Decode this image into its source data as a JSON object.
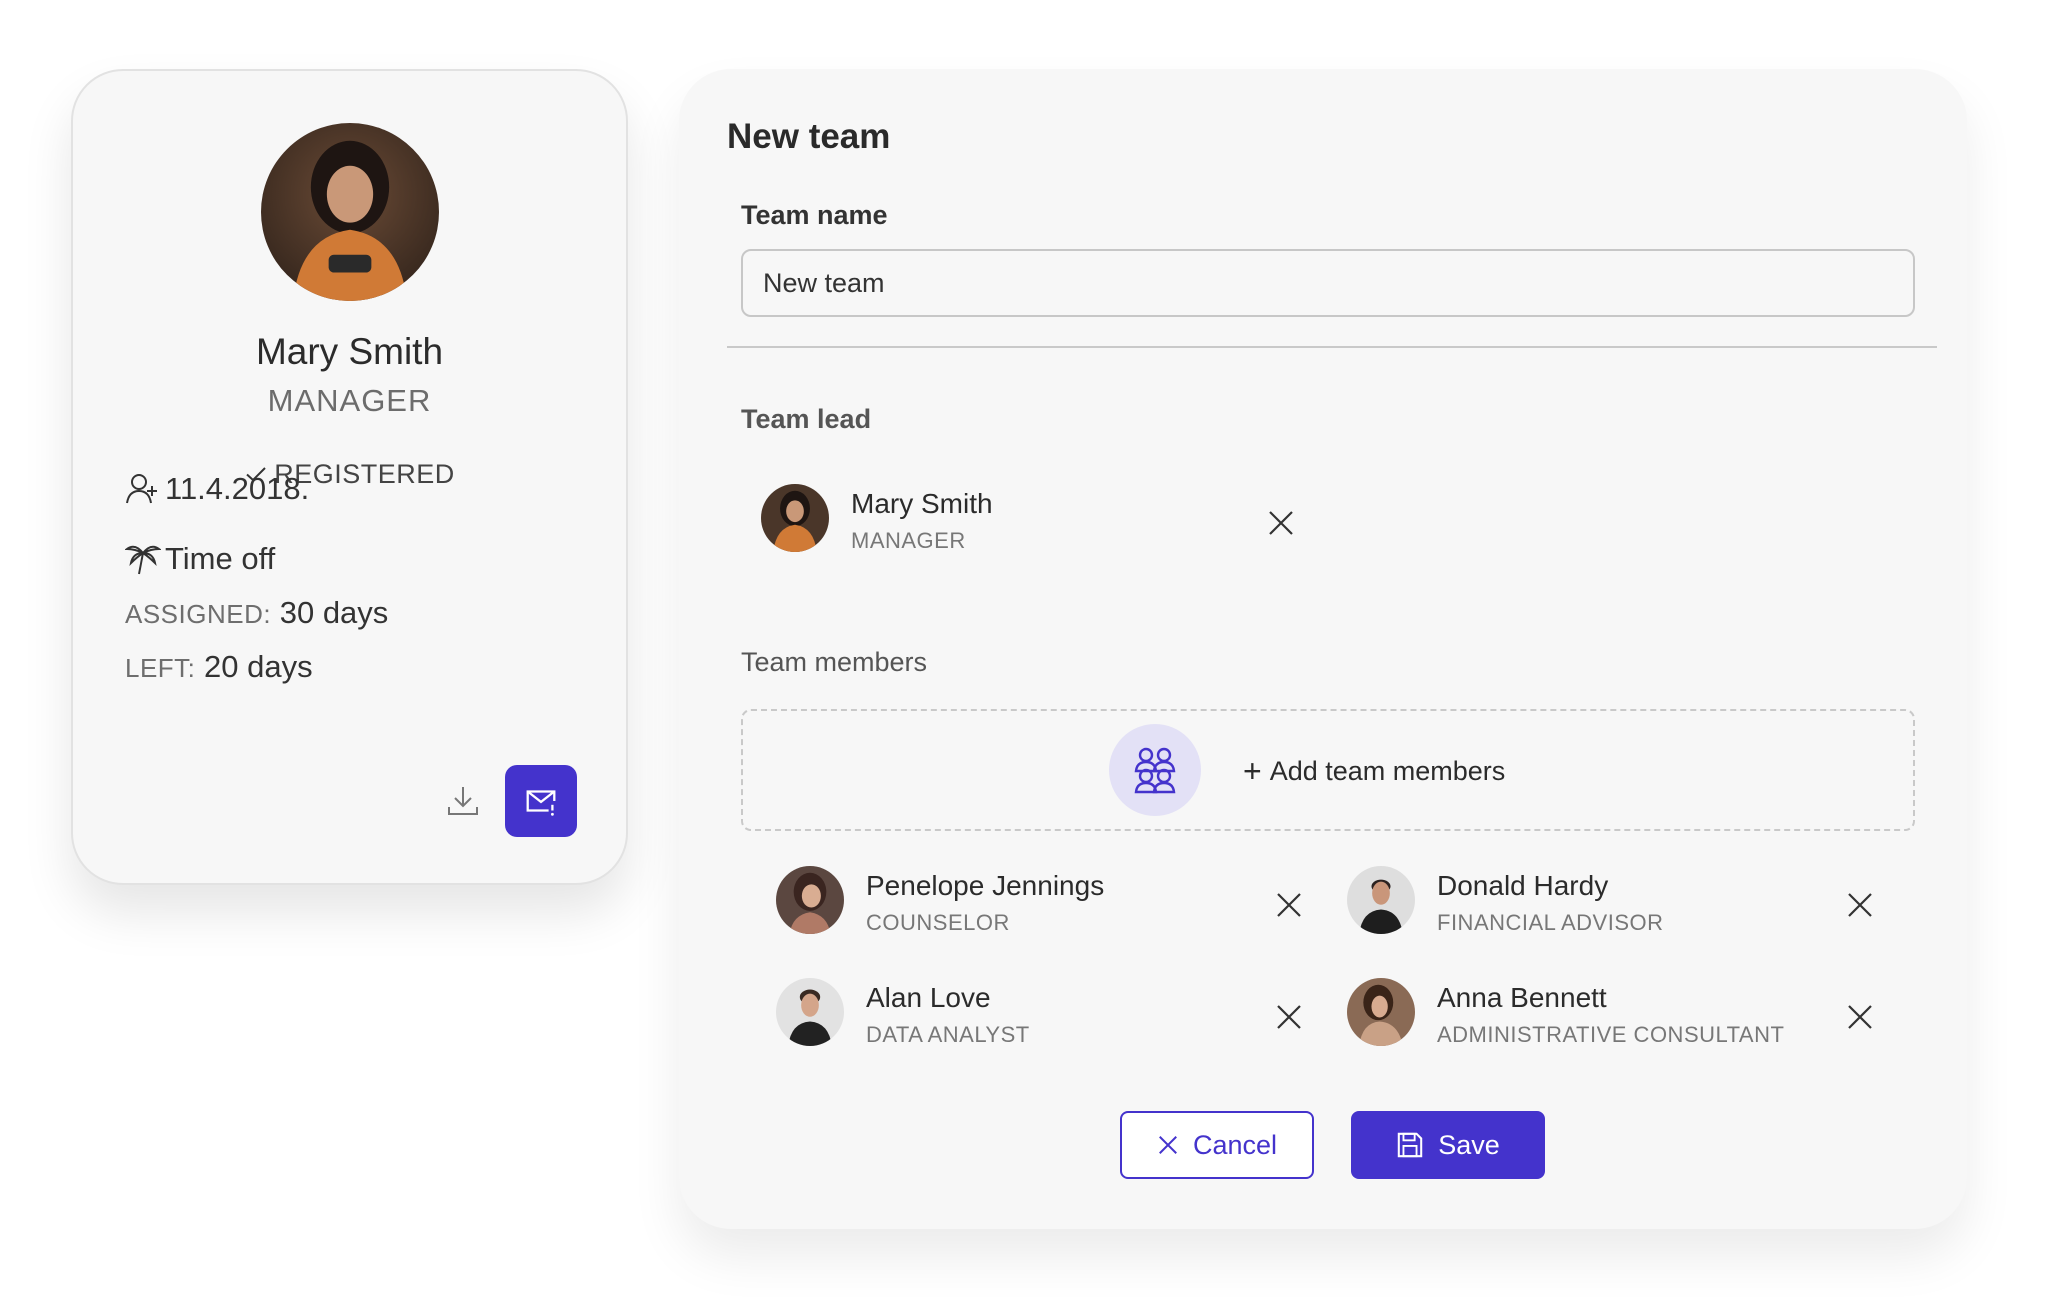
{
  "profile": {
    "name": "Mary Smith",
    "role": "MANAGER",
    "status": "REGISTERED",
    "registered_date": "11.4.2018.",
    "time_off": {
      "title": "Time off",
      "assigned_label": "ASSIGNED:",
      "assigned_value": "30 days",
      "left_label": "LEFT:",
      "left_value": "20 days"
    },
    "icons": [
      "check-icon",
      "user-plus-icon",
      "palm-tree-icon",
      "download-icon",
      "mail-icon"
    ]
  },
  "team_form": {
    "title": "New team",
    "team_name_label": "Team name",
    "team_name_value": "New team",
    "team_lead_label": "Team lead",
    "team_lead": {
      "name": "Mary Smith",
      "role": "MANAGER"
    },
    "team_members_label": "Team members",
    "add_members_label": "Add team members",
    "members": [
      {
        "name": "Penelope Jennings",
        "role": "COUNSELOR"
      },
      {
        "name": "Donald Hardy",
        "role": "FINANCIAL ADVISOR"
      },
      {
        "name": "Alan Love",
        "role": "DATA ANALYST"
      },
      {
        "name": "Anna Bennett",
        "role": "ADMINISTRATIVE CONSULTANT"
      }
    ],
    "cancel_label": "Cancel",
    "save_label": "Save"
  },
  "colors": {
    "accent": "#4433cc",
    "accent_light": "#e3e1f6",
    "card_bg": "#f7f7f7"
  }
}
